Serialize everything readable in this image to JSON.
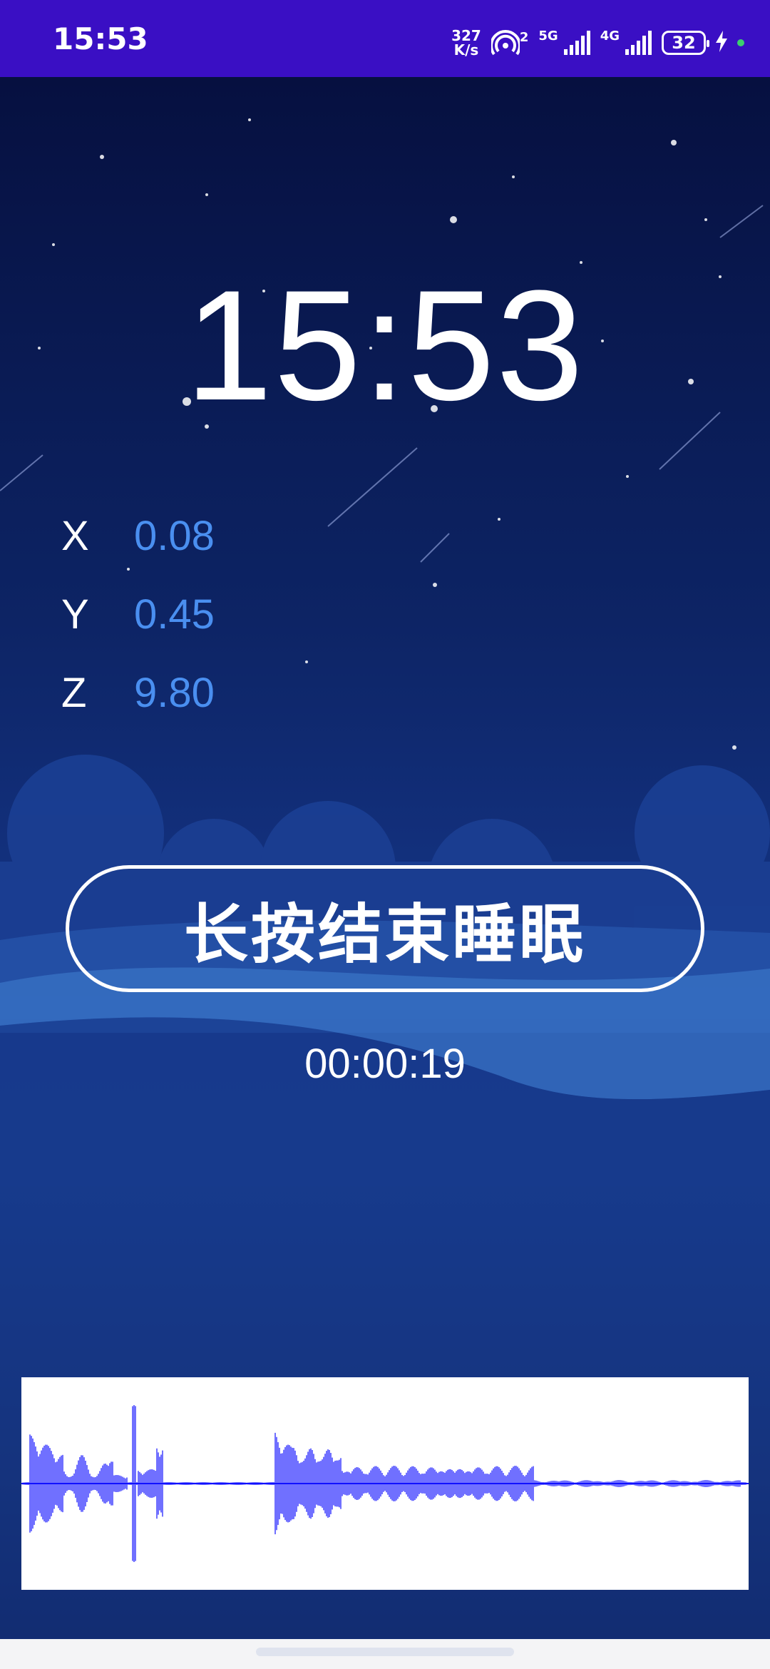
{
  "status_bar": {
    "time": "15:53",
    "net_speed_value": "327",
    "net_speed_unit": "K/s",
    "sim1_label": "5G",
    "sim2_label": "4G",
    "hotspot_badge": "2",
    "battery": "32"
  },
  "clock": {
    "time": "15:53"
  },
  "accelerometer": [
    {
      "axis": "X",
      "value": "0.08"
    },
    {
      "axis": "Y",
      "value": "0.45"
    },
    {
      "axis": "Z",
      "value": "9.80"
    }
  ],
  "end_button_label": "长按结束睡眠",
  "elapsed": "00:00:19",
  "colors": {
    "status_bar": "#3a0fc4",
    "accent_value": "#4a8ff0",
    "waveform": "#1010ff"
  },
  "icons": [
    "hotspot-icon",
    "signal-icon",
    "battery-icon",
    "charging-icon"
  ]
}
